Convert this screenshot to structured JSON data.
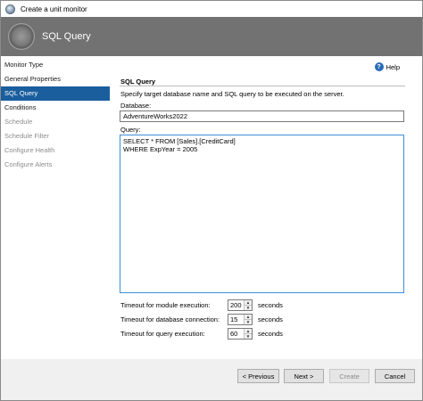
{
  "window": {
    "title": "Create a unit monitor",
    "icon": "monitor-orb-icon"
  },
  "header": {
    "title": "SQL Query"
  },
  "sidebar": {
    "items": [
      {
        "label": "Monitor Type",
        "state": "enabled"
      },
      {
        "label": "General Properties",
        "state": "enabled"
      },
      {
        "label": "SQL Query",
        "state": "selected"
      },
      {
        "label": "Conditions",
        "state": "enabled"
      },
      {
        "label": "Schedule",
        "state": "disabled"
      },
      {
        "label": "Schedule Filter",
        "state": "disabled"
      },
      {
        "label": "Configure Health",
        "state": "disabled"
      },
      {
        "label": "Configure Alerts",
        "state": "disabled"
      }
    ]
  },
  "help": {
    "label": "Help",
    "icon": "help-icon"
  },
  "section": {
    "title": "SQL Query",
    "description": "Specify target database name and SQL query to be executed on the server."
  },
  "database": {
    "label": "Database:",
    "value": "AdventureWorks2022"
  },
  "query": {
    "label": "Query:",
    "value": "SELECT * FROM [Sales].[CreditCard]\nWHERE ExpYear = 2005"
  },
  "timeouts": [
    {
      "label": "Timeout for module execution:",
      "value": "200",
      "unit": "seconds"
    },
    {
      "label": "Timeout for database connection:",
      "value": "15",
      "unit": "seconds"
    },
    {
      "label": "Timeout for query execution:",
      "value": "60",
      "unit": "seconds"
    }
  ],
  "buttons": {
    "previous": "< Previous",
    "next": "Next >",
    "create": "Create",
    "cancel": "Cancel"
  },
  "colors": {
    "header_bg": "#727272",
    "selected_nav": "#1a5e9e",
    "focus_border": "#3d8fd6"
  }
}
